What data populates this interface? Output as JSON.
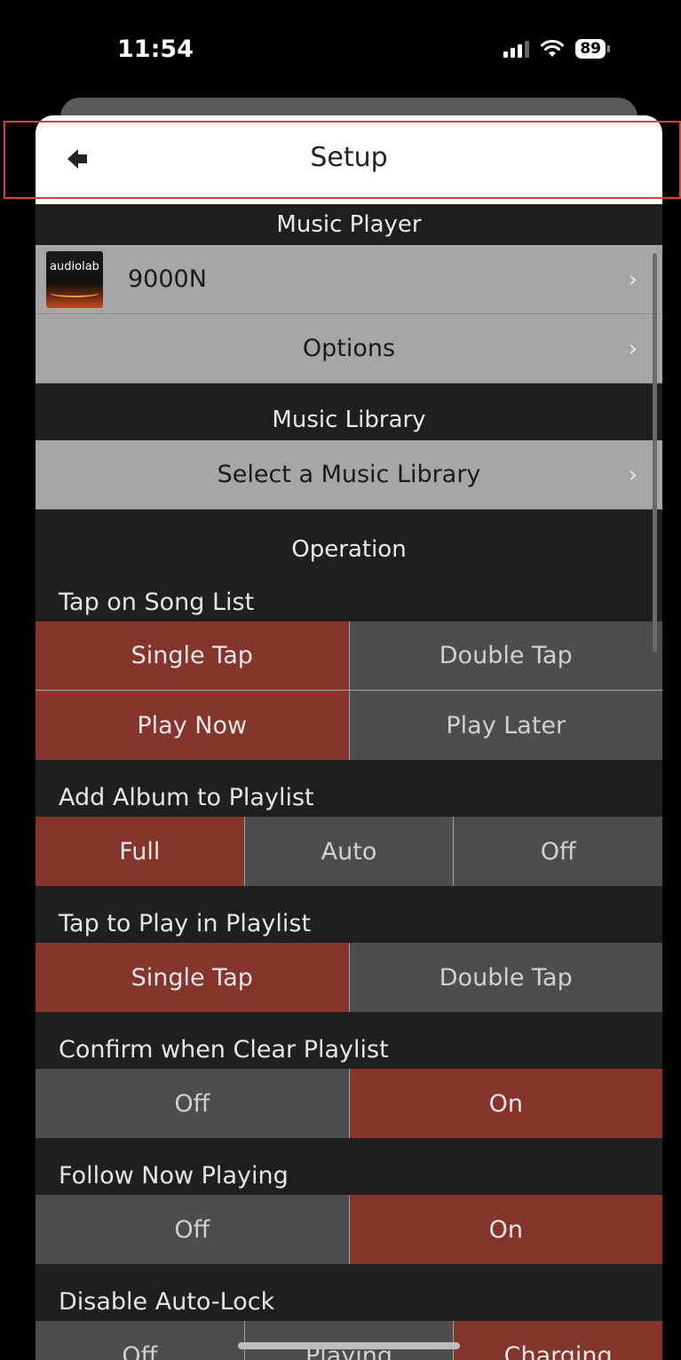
{
  "status": {
    "time": "11:54",
    "battery": "89"
  },
  "nav": {
    "title": "Setup"
  },
  "music_player": {
    "header": "Music Player",
    "device_logo_text": "audiolab",
    "device_name": "9000N",
    "options_label": "Options"
  },
  "music_library": {
    "header": "Music Library",
    "select_label": "Select a Music Library"
  },
  "operation": {
    "header": "Operation",
    "tap_song_list": {
      "label": "Tap on Song List",
      "tap_options": [
        "Single Tap",
        "Double Tap"
      ],
      "play_options": [
        "Play Now",
        "Play Later"
      ]
    },
    "add_album": {
      "label": "Add Album to Playlist",
      "options": [
        "Full",
        "Auto",
        "Off"
      ]
    },
    "tap_play_playlist": {
      "label": "Tap to Play in Playlist",
      "options": [
        "Single Tap",
        "Double Tap"
      ]
    },
    "confirm_clear": {
      "label": "Confirm when Clear Playlist",
      "options": [
        "Off",
        "On"
      ]
    },
    "follow_now_playing": {
      "label": "Follow Now Playing",
      "options": [
        "Off",
        "On"
      ]
    },
    "disable_autolock": {
      "label": "Disable Auto-Lock",
      "options": [
        "Off",
        "Playing",
        "Charging"
      ]
    }
  },
  "colors": {
    "selected": "#85352b",
    "unselected": "#4d4d4f",
    "light_row": "#a6a6a6",
    "highlight_border": "#d9403a"
  }
}
